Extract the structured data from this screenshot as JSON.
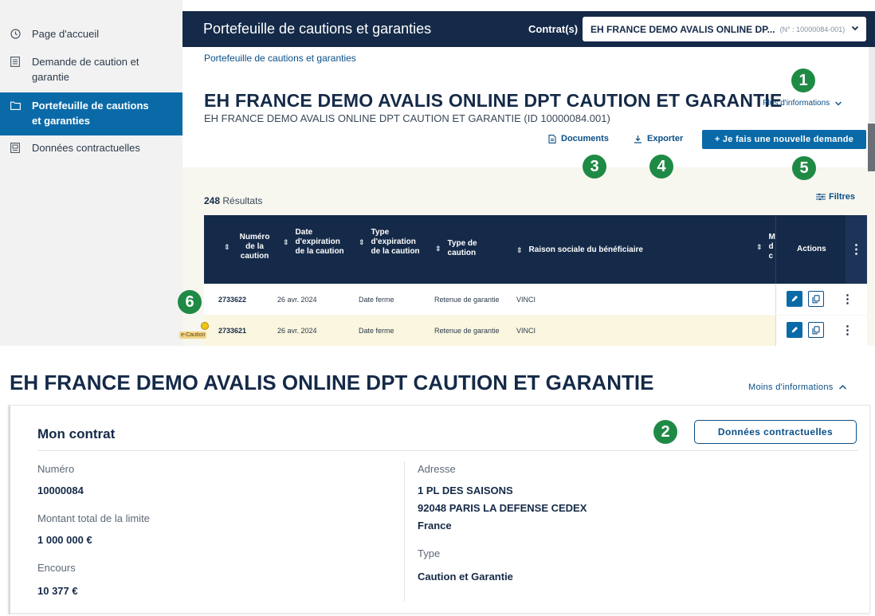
{
  "sidebar": {
    "items": [
      {
        "label": "Page d'accueil",
        "icon": "clock-icon"
      },
      {
        "label": "Demande de caution et garantie",
        "icon": "form-icon"
      },
      {
        "label": "Portefeuille de cautions et garanties",
        "icon": "folder-icon",
        "active": true
      },
      {
        "label": "Données contractuelles",
        "icon": "document-icon"
      }
    ]
  },
  "header": {
    "title": "Portefeuille de cautions et garanties",
    "contrat_label": "Contrat(s)",
    "contract_name": "EH FRANCE DEMO AVALIS ONLINE DP...",
    "contract_number": "(N° : 10000084-001)"
  },
  "breadcrumb": "Portefeuille de cautions et garanties",
  "page": {
    "title": "EH FRANCE DEMO AVALIS ONLINE DPT CAUTION ET GARANTIE",
    "subtitle": "EH FRANCE DEMO AVALIS ONLINE DPT CAUTION ET GARANTIE (ID 10000084.001)",
    "plus_info": "Plus d'informations"
  },
  "actions": {
    "documents": "Documents",
    "exporter": "Exporter",
    "new_request": "+ Je fais une nouvelle demande"
  },
  "markers": [
    "1",
    "2",
    "3",
    "4",
    "5",
    "6"
  ],
  "results": {
    "count": "248",
    "label": "Résultats",
    "filters": "Filtres"
  },
  "table": {
    "headers": {
      "numero": "Numéro de la caution",
      "date_exp": "Date d'expiration de la caution",
      "type_exp": "Type d'expiration de la caution",
      "type_caution": "Type de caution",
      "raison": "Raison sociale du bénéficiaire",
      "montant_partial": "M d c",
      "actions": "Actions"
    },
    "rows": [
      {
        "numero": "2733622",
        "date": "26 avr. 2024",
        "type_exp": "Date ferme",
        "type": "Retenue de garantie",
        "raison": "VINCI"
      },
      {
        "numero": "2733621",
        "date": "26 avr. 2024",
        "type_exp": "Date ferme",
        "type": "Retenue de garantie",
        "raison": "VINCI"
      }
    ],
    "ecaution_tag": "e-Caution"
  },
  "detail": {
    "title": "EH FRANCE DEMO AVALIS ONLINE DPT CAUTION ET GARANTIE",
    "moins_info": "Moins d'informations",
    "section_title": "Mon contrat",
    "button": "Données contractuelles",
    "numero_label": "Numéro",
    "numero_value": "10000084",
    "montant_label": "Montant total de la limite",
    "montant_value": "1 000 000 €",
    "encours_label": "Encours",
    "encours_value": "10 377 €",
    "adresse_label": "Adresse",
    "adresse_line1": "1 PL DES SAISONS",
    "adresse_line2": "92048 PARIS LA DEFENSE CEDEX",
    "adresse_line3": "France",
    "type_label": "Type",
    "type_value": "Caution et Garantie"
  },
  "colors": {
    "navy": "#152a48",
    "blue": "#0a6aa8",
    "green_marker": "#1f8a45",
    "highlight_row": "#faf6df"
  }
}
